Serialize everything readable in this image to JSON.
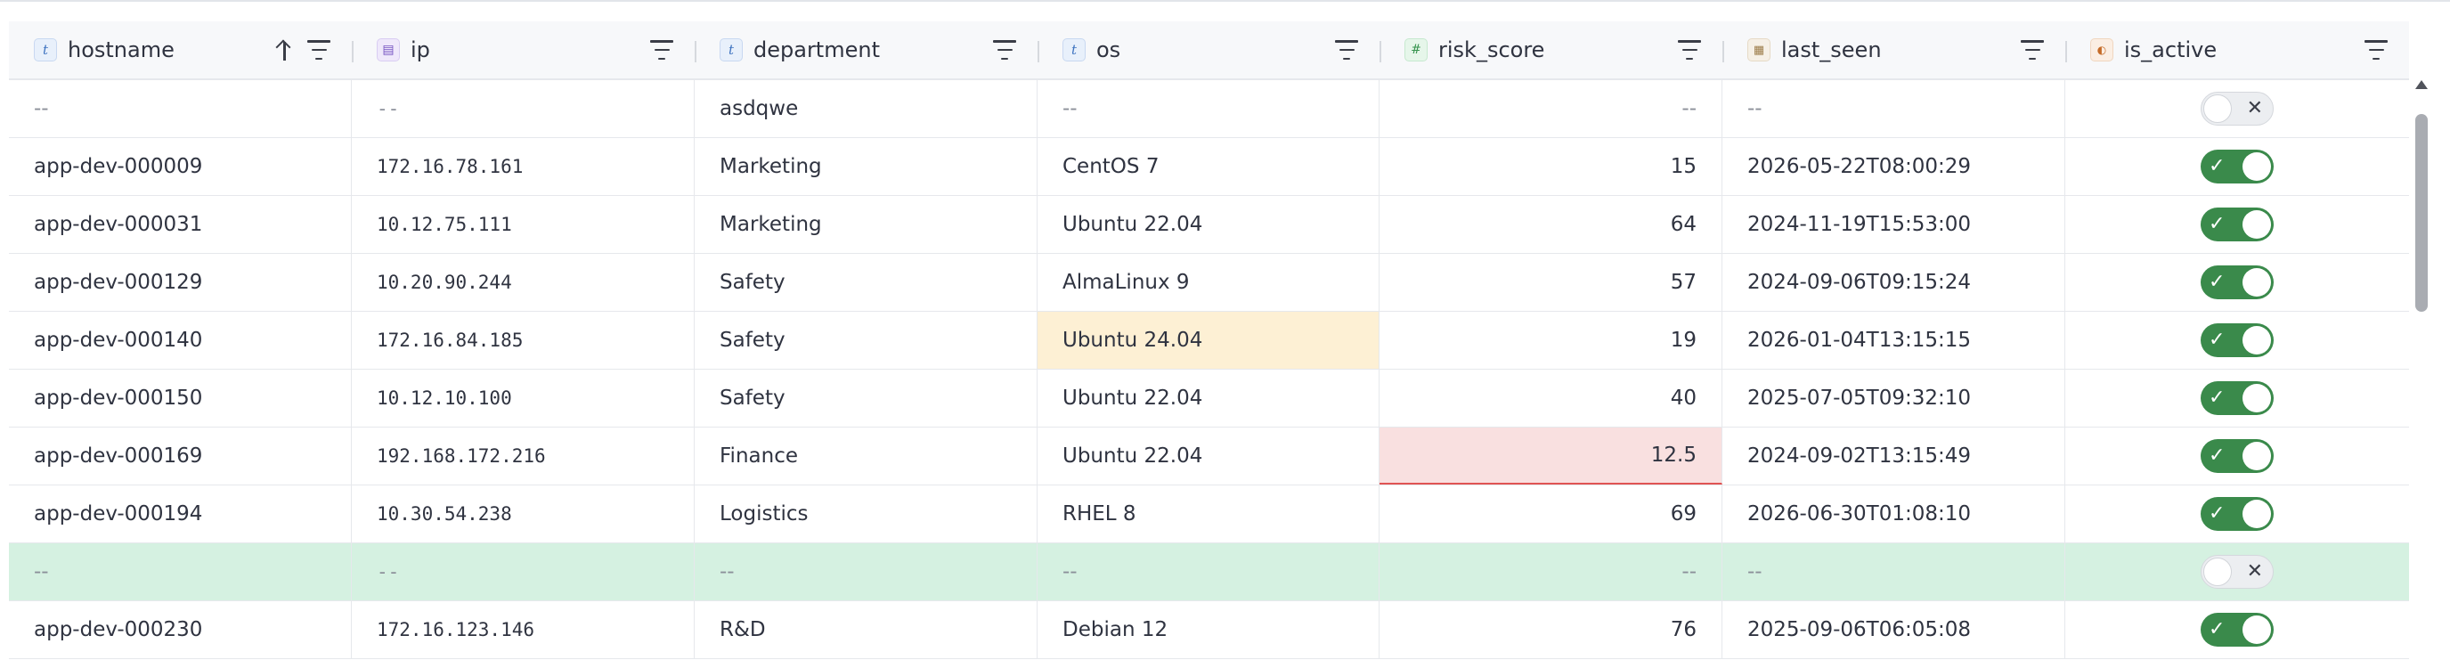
{
  "columns": [
    {
      "name": "hostname",
      "type_icon": "text-type-icon",
      "type_glyph": "t",
      "sorted": "ascending"
    },
    {
      "name": "ip",
      "type_icon": "ip-type-icon",
      "type_glyph": "▤"
    },
    {
      "name": "department",
      "type_icon": "text-type-icon",
      "type_glyph": "t"
    },
    {
      "name": "os",
      "type_icon": "text-type-icon",
      "type_glyph": "t"
    },
    {
      "name": "risk_score",
      "type_icon": "number-type-icon",
      "type_glyph": "#"
    },
    {
      "name": "last_seen",
      "type_icon": "date-type-icon",
      "type_glyph": "▦"
    },
    {
      "name": "is_active",
      "type_icon": "boolean-type-icon",
      "type_glyph": "◐"
    }
  ],
  "rows": [
    {
      "hostname": "--",
      "ip": "--",
      "department": "asdqwe",
      "os": "--",
      "risk_score": "--",
      "last_seen": "--",
      "is_active": false
    },
    {
      "hostname": "app-dev-000009",
      "ip": "172.16.78.161",
      "department": "Marketing",
      "os": "CentOS 7",
      "risk_score": "15",
      "last_seen": "2026-05-22T08:00:29",
      "is_active": true
    },
    {
      "hostname": "app-dev-000031",
      "ip": "10.12.75.111",
      "department": "Marketing",
      "os": "Ubuntu 22.04",
      "risk_score": "64",
      "last_seen": "2024-11-19T15:53:00",
      "is_active": true
    },
    {
      "hostname": "app-dev-000129",
      "ip": "10.20.90.244",
      "department": "Safety",
      "os": "AlmaLinux 9",
      "risk_score": "57",
      "last_seen": "2024-09-06T09:15:24",
      "is_active": true
    },
    {
      "hostname": "app-dev-000140",
      "ip": "172.16.84.185",
      "department": "Safety",
      "os": "Ubuntu 24.04",
      "risk_score": "19",
      "last_seen": "2026-01-04T13:15:15",
      "is_active": true,
      "modified": "os"
    },
    {
      "hostname": "app-dev-000150",
      "ip": "10.12.10.100",
      "department": "Safety",
      "os": "Ubuntu 22.04",
      "risk_score": "40",
      "last_seen": "2025-07-05T09:32:10",
      "is_active": true
    },
    {
      "hostname": "app-dev-000169",
      "ip": "192.168.172.216",
      "department": "Finance",
      "os": "Ubuntu 22.04",
      "risk_score": "12.5",
      "last_seen": "2024-09-02T13:15:49",
      "is_active": true,
      "invalid": "risk_score"
    },
    {
      "hostname": "app-dev-000194",
      "ip": "10.30.54.238",
      "department": "Logistics",
      "os": "RHEL 8",
      "risk_score": "69",
      "last_seen": "2026-06-30T01:08:10",
      "is_active": true
    },
    {
      "hostname": "--",
      "ip": "--",
      "department": "--",
      "os": "--",
      "risk_score": "--",
      "last_seen": "--",
      "is_active": false,
      "added": true
    },
    {
      "hostname": "app-dev-000230",
      "ip": "172.16.123.146",
      "department": "R&D",
      "os": "Debian 12",
      "risk_score": "76",
      "last_seen": "2025-09-06T06:05:08",
      "is_active": true
    }
  ],
  "toggle_glyphs": {
    "on": "✓",
    "off": "✕"
  },
  "colors": {
    "added_row": "#d5f1e1",
    "modified_cell": "#fdf0d4",
    "invalid_cell": "#f9e0e0",
    "toggle_on": "#3a8a4b",
    "accent": "#3f73c0"
  }
}
